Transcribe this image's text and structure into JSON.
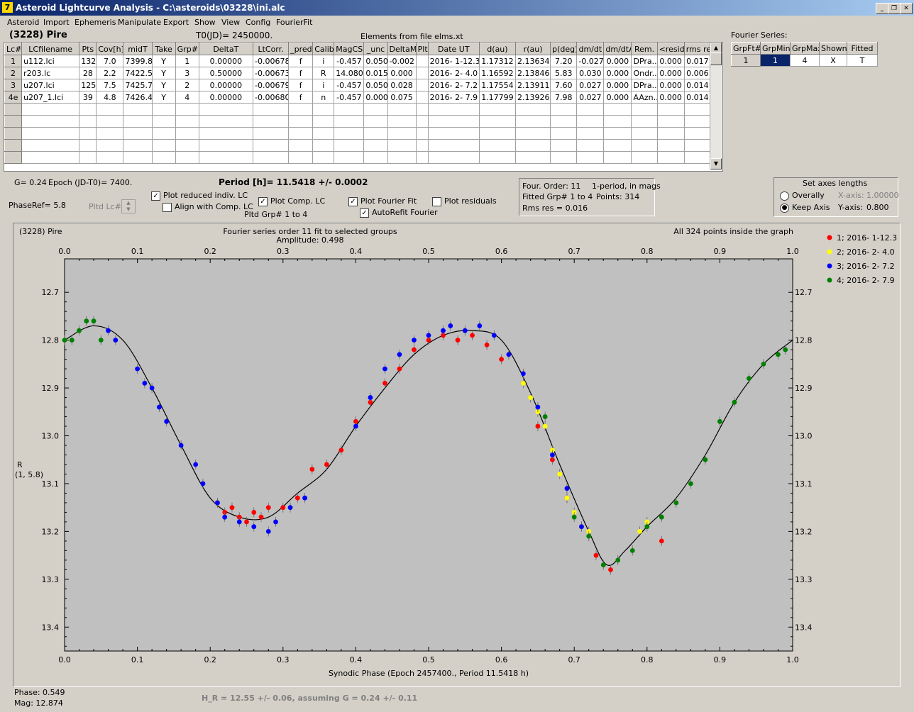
{
  "window": {
    "title": "Asteroid Lightcurve Analysis - C:\\asteroids\\03228\\ini.alc",
    "icon": "7"
  },
  "menu": [
    "Asteroid",
    "Import",
    "Ephemeris",
    "Manipulate",
    "Export",
    "Show",
    "View",
    "Config",
    "FourierFit"
  ],
  "header": {
    "asteroid": "(3228) Pire",
    "t0": "T0(JD)= 2450000.",
    "elements": "Elements from file elms.xt",
    "fourier_title": "Fourier Series:"
  },
  "lc_table": {
    "columns": [
      "Lc#",
      "LCfilename",
      "Pts",
      "Cov[h]",
      "midT",
      "Take",
      "Grp#",
      "DeltaT",
      "LtCorr.",
      "_pred.",
      "Calib",
      "MagCS",
      "_unc",
      "DeltaM",
      "Plt",
      "Date UT",
      "d(au)",
      "r(au)",
      "p(deg)",
      "dm/dt",
      "dm/dtA",
      "Rem.",
      "<resid>",
      "rms res"
    ],
    "rows": [
      [
        "1",
        "u112.lci",
        "132",
        "7.0",
        "7399.8",
        "Y",
        "1",
        "0.00000",
        "-0.00678",
        "f",
        "i",
        "-0.457",
        "0.050",
        "-0.002",
        "",
        "2016- 1-12.3",
        "1.17312",
        "2.13634",
        "7.20",
        "-0.027",
        "0.000",
        "DPra...",
        "0.000",
        "0.017"
      ],
      [
        "2",
        "r203.lc",
        "28",
        "2.2",
        "7422.5",
        "Y",
        "3",
        "0.50000",
        "-0.00673",
        "f",
        "R",
        "14.080",
        "0.015",
        "0.000",
        "",
        "2016- 2- 4.0",
        "1.16592",
        "2.13846",
        "5.83",
        "0.030",
        "0.000",
        "Ondr...",
        "0.000",
        "0.006"
      ],
      [
        "3",
        "u207.lci",
        "125",
        "7.5",
        "7425.7",
        "Y",
        "2",
        "0.00000",
        "-0.00679",
        "f",
        "i",
        "-0.457",
        "0.050",
        "0.028",
        "",
        "2016- 2- 7.2",
        "1.17554",
        "2.13911",
        "7.60",
        "0.027",
        "0.000",
        "DPra...",
        "0.000",
        "0.014"
      ],
      [
        "4e",
        "u207_1.lci",
        "39",
        "4.8",
        "7426.4",
        "Y",
        "4",
        "0.00000",
        "-0.00680",
        "f",
        "n",
        "-0.457",
        "0.000",
        "0.075",
        "",
        "2016- 2- 7.9",
        "1.17799",
        "2.13926",
        "7.98",
        "0.027",
        "0.000",
        "AAzn...",
        "0.000",
        "0.014"
      ]
    ]
  },
  "fourier_table": {
    "columns": [
      "GrpFt#",
      "GrpMin",
      "GrpMax",
      "Shown",
      "Fitted"
    ],
    "row": [
      "1",
      "1",
      "4",
      "X",
      "T"
    ]
  },
  "controls": {
    "g": "G= 0.24",
    "epoch": "Epoch (JD-T0)= 7400.",
    "period": "Period [h]= 11.5418 +/- 0.0002",
    "phase_ref": "PhaseRef= 5.8",
    "pltd_lc": "Pltd Lc#:",
    "plot_reduced": "Plot reduced indiv. LC",
    "align": "Align with Comp. LC",
    "plot_comp": "Plot Comp. LC",
    "pltd_grp": "Pltd Grp#  1   to   4",
    "plot_fourier": "Plot Fourier Fit",
    "autorefit": "AutoRefit Fourier",
    "plot_residuals": "Plot residuals",
    "info": [
      "Four. Order: 11",
      "1-period, in mags",
      "Fitted Grp# 1 to 4",
      "Points: 314",
      "Rms res     = 0.016"
    ],
    "axes_title": "Set axes lengths",
    "overally": "Overally",
    "keep_axis": "Keep Axis",
    "xaxis_label": "X-axis:",
    "xaxis_val": "1.00000",
    "yaxis_label": "Y-axis:",
    "yaxis_val": "0.800"
  },
  "plot": {
    "name": "(3228) Pire",
    "title": "Fourier series order 11 fit to selected groups",
    "amplitude": "Amplitude: 0.498",
    "inside": "All 324 points inside the graph",
    "ylabel": "R",
    "ylabel2": "(1, 5.8)",
    "xlabel": "Synodic Phase (Epoch 2457400., Period 11.5418 h)",
    "legend": [
      {
        "label": "1; 2016- 1-12.3",
        "color": "#ff0000"
      },
      {
        "label": "2; 2016- 2- 4.0",
        "color": "#ffff00"
      },
      {
        "label": "3; 2016- 2- 7.2",
        "color": "#0000ff"
      },
      {
        "label": "4; 2016- 2- 7.9",
        "color": "#008000"
      }
    ]
  },
  "footer": {
    "phase": "Phase:  0.549",
    "mag": "Mag:   12.874",
    "hr": "H_R = 12.55 +/- 0.06, assuming G = 0.24 +/- 0.11"
  },
  "chart_data": {
    "type": "scatter",
    "xlim": [
      0,
      1
    ],
    "ylim": [
      13.45,
      12.63
    ],
    "y_inverted": true,
    "xticks": [
      "0.0",
      "0.1",
      "0.2",
      "0.3",
      "0.4",
      "0.5",
      "0.6",
      "0.7",
      "0.8",
      "0.9",
      "1.0"
    ],
    "yticks": [
      "12.7",
      "12.8",
      "12.9",
      "13.0",
      "13.1",
      "13.2",
      "13.3",
      "13.4"
    ],
    "fit_curve": [
      [
        0,
        12.8
      ],
      [
        0.04,
        12.77
      ],
      [
        0.08,
        12.8
      ],
      [
        0.12,
        12.9
      ],
      [
        0.16,
        13.02
      ],
      [
        0.2,
        13.13
      ],
      [
        0.24,
        13.17
      ],
      [
        0.28,
        13.17
      ],
      [
        0.32,
        13.12
      ],
      [
        0.36,
        13.07
      ],
      [
        0.4,
        12.98
      ],
      [
        0.44,
        12.9
      ],
      [
        0.48,
        12.83
      ],
      [
        0.52,
        12.79
      ],
      [
        0.56,
        12.78
      ],
      [
        0.6,
        12.8
      ],
      [
        0.64,
        12.91
      ],
      [
        0.68,
        13.06
      ],
      [
        0.72,
        13.2
      ],
      [
        0.745,
        13.27
      ],
      [
        0.77,
        13.24
      ],
      [
        0.8,
        13.19
      ],
      [
        0.84,
        13.13
      ],
      [
        0.88,
        13.04
      ],
      [
        0.92,
        12.93
      ],
      [
        0.96,
        12.85
      ],
      [
        1.0,
        12.8
      ]
    ],
    "series": [
      {
        "name": "1; 2016- 1-12.3",
        "color": "#ff0000",
        "points": [
          [
            0.21,
            13.14
          ],
          [
            0.22,
            13.16
          ],
          [
            0.23,
            13.15
          ],
          [
            0.24,
            13.17
          ],
          [
            0.25,
            13.18
          ],
          [
            0.26,
            13.16
          ],
          [
            0.27,
            13.17
          ],
          [
            0.28,
            13.15
          ],
          [
            0.3,
            13.15
          ],
          [
            0.32,
            13.13
          ],
          [
            0.34,
            13.07
          ],
          [
            0.36,
            13.06
          ],
          [
            0.38,
            13.03
          ],
          [
            0.4,
            12.97
          ],
          [
            0.42,
            12.93
          ],
          [
            0.44,
            12.89
          ],
          [
            0.46,
            12.86
          ],
          [
            0.48,
            12.82
          ],
          [
            0.5,
            12.8
          ],
          [
            0.52,
            12.79
          ],
          [
            0.54,
            12.8
          ],
          [
            0.56,
            12.79
          ],
          [
            0.58,
            12.81
          ],
          [
            0.6,
            12.84
          ],
          [
            0.65,
            12.98
          ],
          [
            0.67,
            13.05
          ],
          [
            0.69,
            13.13
          ],
          [
            0.71,
            13.19
          ],
          [
            0.73,
            13.25
          ],
          [
            0.75,
            13.28
          ],
          [
            0.82,
            13.22
          ]
        ]
      },
      {
        "name": "2; 2016- 2- 4.0",
        "color": "#ffff00",
        "points": [
          [
            0.63,
            12.89
          ],
          [
            0.64,
            12.92
          ],
          [
            0.65,
            12.95
          ],
          [
            0.66,
            12.98
          ],
          [
            0.67,
            13.03
          ],
          [
            0.68,
            13.08
          ],
          [
            0.69,
            13.13
          ],
          [
            0.7,
            13.16
          ],
          [
            0.71,
            13.19
          ],
          [
            0.72,
            13.2
          ],
          [
            0.79,
            13.2
          ],
          [
            0.8,
            13.18
          ]
        ]
      },
      {
        "name": "3; 2016- 2- 7.2",
        "color": "#0000ff",
        "points": [
          [
            0.06,
            12.78
          ],
          [
            0.07,
            12.8
          ],
          [
            0.1,
            12.86
          ],
          [
            0.11,
            12.89
          ],
          [
            0.12,
            12.9
          ],
          [
            0.13,
            12.94
          ],
          [
            0.14,
            12.97
          ],
          [
            0.16,
            13.02
          ],
          [
            0.18,
            13.06
          ],
          [
            0.19,
            13.1
          ],
          [
            0.21,
            13.14
          ],
          [
            0.22,
            13.17
          ],
          [
            0.24,
            13.18
          ],
          [
            0.26,
            13.19
          ],
          [
            0.28,
            13.2
          ],
          [
            0.29,
            13.18
          ],
          [
            0.31,
            13.15
          ],
          [
            0.33,
            13.13
          ],
          [
            0.4,
            12.98
          ],
          [
            0.42,
            12.92
          ],
          [
            0.44,
            12.86
          ],
          [
            0.46,
            12.83
          ],
          [
            0.48,
            12.8
          ],
          [
            0.5,
            12.79
          ],
          [
            0.52,
            12.78
          ],
          [
            0.53,
            12.77
          ],
          [
            0.55,
            12.78
          ],
          [
            0.57,
            12.77
          ],
          [
            0.59,
            12.79
          ],
          [
            0.61,
            12.83
          ],
          [
            0.63,
            12.87
          ],
          [
            0.65,
            12.94
          ],
          [
            0.67,
            13.04
          ],
          [
            0.69,
            13.11
          ],
          [
            0.71,
            13.19
          ]
        ]
      },
      {
        "name": "4; 2016- 2- 7.9",
        "color": "#008000",
        "points": [
          [
            0.0,
            12.8
          ],
          [
            0.01,
            12.8
          ],
          [
            0.02,
            12.78
          ],
          [
            0.03,
            12.76
          ],
          [
            0.04,
            12.76
          ],
          [
            0.05,
            12.8
          ],
          [
            0.66,
            12.96
          ],
          [
            0.7,
            13.17
          ],
          [
            0.72,
            13.21
          ],
          [
            0.74,
            13.27
          ],
          [
            0.76,
            13.26
          ],
          [
            0.78,
            13.24
          ],
          [
            0.8,
            13.19
          ],
          [
            0.82,
            13.17
          ],
          [
            0.84,
            13.14
          ],
          [
            0.86,
            13.1
          ],
          [
            0.88,
            13.05
          ],
          [
            0.9,
            12.97
          ],
          [
            0.92,
            12.93
          ],
          [
            0.94,
            12.88
          ],
          [
            0.96,
            12.85
          ],
          [
            0.98,
            12.83
          ],
          [
            0.99,
            12.82
          ]
        ]
      }
    ]
  }
}
